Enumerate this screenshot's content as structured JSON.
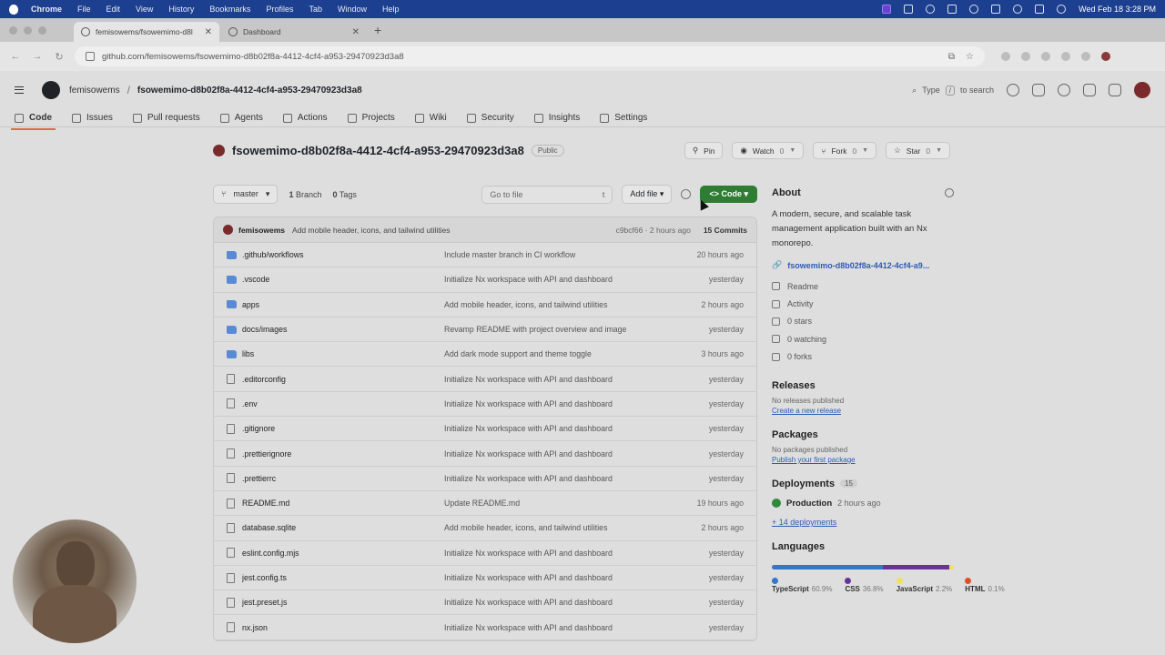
{
  "menubar": {
    "items": [
      "Chrome",
      "File",
      "Edit",
      "View",
      "History",
      "Bookmarks",
      "Profiles",
      "Tab",
      "Window",
      "Help"
    ],
    "clock": "Wed Feb 18  3:28 PM"
  },
  "browser": {
    "tabs": [
      {
        "label": "femisowems/fsowemimo-d8l",
        "active": true
      },
      {
        "label": "Dashboard",
        "active": false
      }
    ],
    "url": "github.com/femisowems/fsowemimo-d8b02f8a-4412-4cf4-a953-29470923d3a8"
  },
  "gh": {
    "owner": "femisowems",
    "repo": "fsowemimo-d8b02f8a-4412-4cf4-a953-29470923d3a8",
    "search": {
      "prefix": "Type",
      "key": "/",
      "suffix": "to search"
    },
    "tabs": [
      "Code",
      "Issues",
      "Pull requests",
      "Agents",
      "Actions",
      "Projects",
      "Wiki",
      "Security",
      "Insights",
      "Settings"
    ],
    "visibility": "Public",
    "pin_label": "Pin",
    "watch": {
      "label": "Watch",
      "count": "0"
    },
    "fork": {
      "label": "Fork",
      "count": "0"
    },
    "star": {
      "label": "Star",
      "count": "0"
    },
    "branch": "master",
    "branches_count": "1",
    "branches_label": "Branch",
    "tags_count": "0",
    "tags_label": "Tags",
    "goto_file": "Go to file",
    "goto_key": "t",
    "add_file": "Add file",
    "code_button": "Code",
    "latest_commit": {
      "author": "femisowems",
      "message": "Add mobile header, icons, and tailwind utilities",
      "hash_time": "c9bcf66 · 2 hours ago",
      "commits": "15 Commits"
    },
    "files": [
      {
        "type": "folder",
        "name": ".github/workflows",
        "message": "Include master branch in CI workflow",
        "time": "20 hours ago"
      },
      {
        "type": "folder",
        "name": ".vscode",
        "message": "Initialize Nx workspace with API and dashboard",
        "time": "yesterday"
      },
      {
        "type": "folder",
        "name": "apps",
        "message": "Add mobile header, icons, and tailwind utilities",
        "time": "2 hours ago"
      },
      {
        "type": "folder",
        "name": "docs/images",
        "message": "Revamp README with project overview and image",
        "time": "yesterday"
      },
      {
        "type": "folder",
        "name": "libs",
        "message": "Add dark mode support and theme toggle",
        "time": "3 hours ago"
      },
      {
        "type": "file",
        "name": ".editorconfig",
        "message": "Initialize Nx workspace with API and dashboard",
        "time": "yesterday"
      },
      {
        "type": "file",
        "name": ".env",
        "message": "Initialize Nx workspace with API and dashboard",
        "time": "yesterday"
      },
      {
        "type": "file",
        "name": ".gitignore",
        "message": "Initialize Nx workspace with API and dashboard",
        "time": "yesterday"
      },
      {
        "type": "file",
        "name": ".prettierignore",
        "message": "Initialize Nx workspace with API and dashboard",
        "time": "yesterday"
      },
      {
        "type": "file",
        "name": ".prettierrc",
        "message": "Initialize Nx workspace with API and dashboard",
        "time": "yesterday"
      },
      {
        "type": "file",
        "name": "README.md",
        "message": "Update README.md",
        "time": "19 hours ago"
      },
      {
        "type": "file",
        "name": "database.sqlite",
        "message": "Add mobile header, icons, and tailwind utilities",
        "time": "2 hours ago"
      },
      {
        "type": "file",
        "name": "eslint.config.mjs",
        "message": "Initialize Nx workspace with API and dashboard",
        "time": "yesterday"
      },
      {
        "type": "file",
        "name": "jest.config.ts",
        "message": "Initialize Nx workspace with API and dashboard",
        "time": "yesterday"
      },
      {
        "type": "file",
        "name": "jest.preset.js",
        "message": "Initialize Nx workspace with API and dashboard",
        "time": "yesterday"
      },
      {
        "type": "file",
        "name": "nx.json",
        "message": "Initialize Nx workspace with API and dashboard",
        "time": "yesterday"
      }
    ],
    "about": {
      "heading": "About",
      "description": "A modern, secure, and scalable task management application built with an Nx monorepo.",
      "link": "fsowemimo-d8b02f8a-4412-4cf4-a9...",
      "items": [
        "Readme",
        "Activity",
        "0 stars",
        "0 watching",
        "0 forks"
      ]
    },
    "releases": {
      "heading": "Releases",
      "none": "No releases published",
      "create": "Create a new release"
    },
    "packages": {
      "heading": "Packages",
      "none": "No packages published",
      "publish": "Publish your first package"
    },
    "deployments": {
      "heading": "Deployments",
      "count": "15",
      "env": "Production",
      "time": "2 hours ago",
      "more": "+ 14 deployments"
    },
    "languages": {
      "heading": "Languages",
      "items": [
        {
          "name": "TypeScript",
          "pct": "60.9%",
          "value": 60.9,
          "color": "#3178c6"
        },
        {
          "name": "CSS",
          "pct": "36.8%",
          "value": 36.8,
          "color": "#663399"
        },
        {
          "name": "JavaScript",
          "pct": "2.2%",
          "value": 2.2,
          "color": "#f1e05a"
        },
        {
          "name": "HTML",
          "pct": "0.1%",
          "value": 0.1,
          "color": "#e34c26"
        }
      ]
    }
  }
}
